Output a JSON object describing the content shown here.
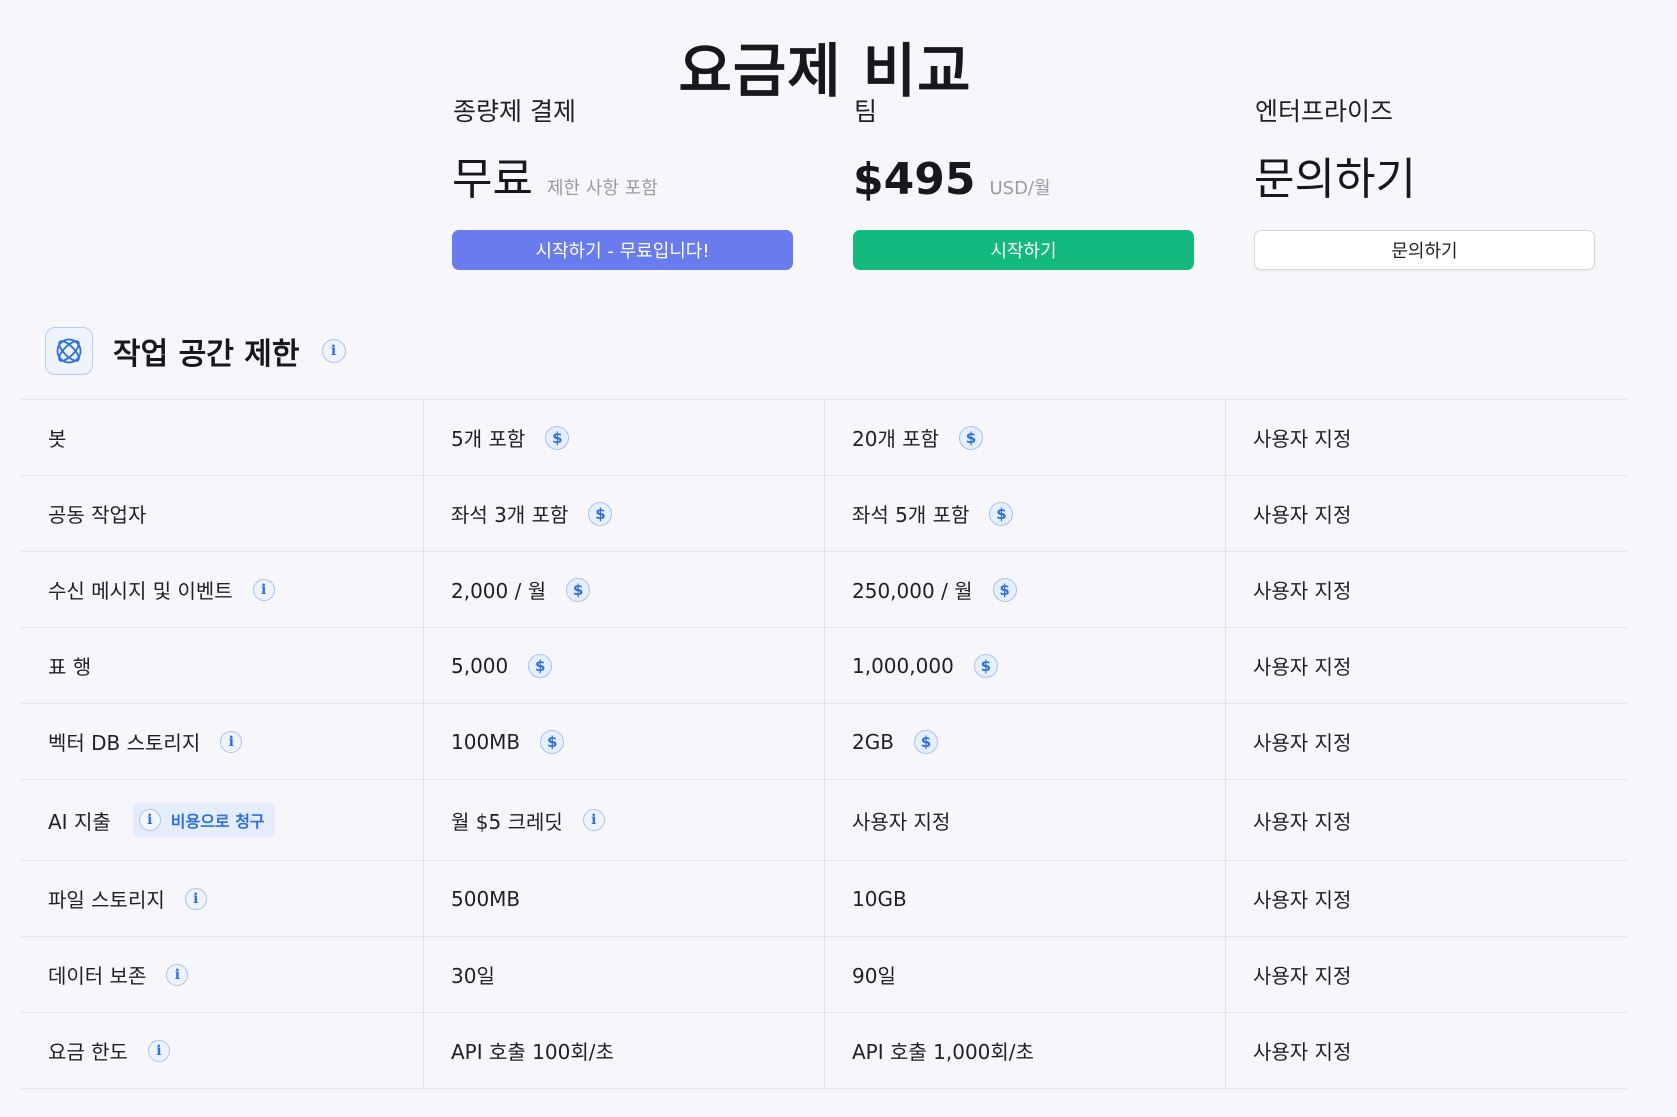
{
  "page": {
    "title": "요금제 비교"
  },
  "plans": [
    {
      "name": "종량제 결제",
      "price": "무료",
      "price_note": "제한 사항 포함",
      "button_label": "시작하기 - 무료입니다!",
      "button_color": "#6a7bee"
    },
    {
      "name": "팀",
      "price": "$495",
      "price_note": "USD/월",
      "button_label": "시작하기",
      "button_color": "#13b97e"
    },
    {
      "name": "엔터프라이즈",
      "price": "문의하기",
      "price_note": "",
      "button_label": "문의하기",
      "button_color": "#ffffff"
    }
  ],
  "section": {
    "title": "작업 공간 제한",
    "icon": "atom-icon",
    "info_icon": "info-icon"
  },
  "icons": {
    "info": "i",
    "dollar": "$"
  },
  "rows": [
    {
      "label": "봇",
      "free": "5개 포함",
      "team": "20개 포함",
      "enterprise": "사용자 지정"
    },
    {
      "label": "공동 작업자",
      "free": "좌석 3개 포함",
      "team": "좌석 5개 포함",
      "enterprise": "사용자 지정"
    },
    {
      "label": "수신 메시지 및 이벤트",
      "free": "2,000 / 월",
      "team": "250,000 / 월",
      "enterprise": "사용자 지정"
    },
    {
      "label": "표 행",
      "free": "5,000",
      "team": "1,000,000",
      "enterprise": "사용자 지정"
    },
    {
      "label": "벡터 DB 스토리지",
      "free": "100MB",
      "team": "2GB",
      "enterprise": "사용자 지정"
    },
    {
      "label": "AI 지출",
      "badge": "비용으로 청구",
      "free": "월 $5 크레딧",
      "team": "사용자 지정",
      "enterprise": "사용자 지정"
    },
    {
      "label": "파일 스토리지",
      "free": "500MB",
      "team": "10GB",
      "enterprise": "사용자 지정"
    },
    {
      "label": "데이터 보존",
      "free": "30일",
      "team": "90일",
      "enterprise": "사용자 지정"
    },
    {
      "label": "요금 한도",
      "free": "API 호출 100회/초",
      "team": "API 호출 1,000회/초",
      "enterprise": "사용자 지정"
    }
  ],
  "colors": {
    "background": "#f7f7fb",
    "accent_blue": "#2f6fdc",
    "free_button": "#6a7bee",
    "team_button": "#13b97e"
  }
}
